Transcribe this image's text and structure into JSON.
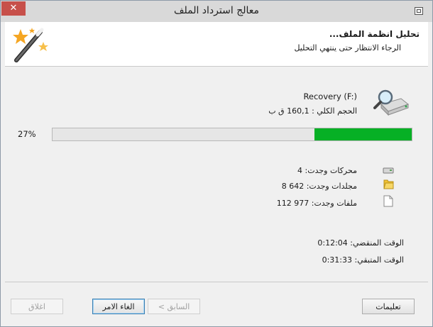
{
  "window": {
    "title": "معالج استرداد الملف"
  },
  "header": {
    "title": "تحليل انظمة الملف...",
    "subtitle": "الرجاء الانتظار حتى ينتهي التحليل"
  },
  "drive": {
    "name": "Recovery (F:)",
    "size": "الحجم الكلي : 160,1 ق ب"
  },
  "progress": {
    "label": "27%",
    "value": 0.27
  },
  "stats": {
    "drives": "محركات وجدت: 4",
    "folders": "مجلدات وجدت: 642 8",
    "files": "ملفات وجدت: 977 112"
  },
  "times": {
    "elapsed": "الوقت المنقضي: 0:12:04",
    "remaining": "الوقت المتبقي: 0:31:33"
  },
  "buttons": {
    "help": "تعليمات",
    "back": "< السابق",
    "cancel": "الغاء الامر",
    "close": "اغلاق"
  },
  "colors": {
    "progress": "#06b025",
    "close_button": "#c7504a"
  }
}
